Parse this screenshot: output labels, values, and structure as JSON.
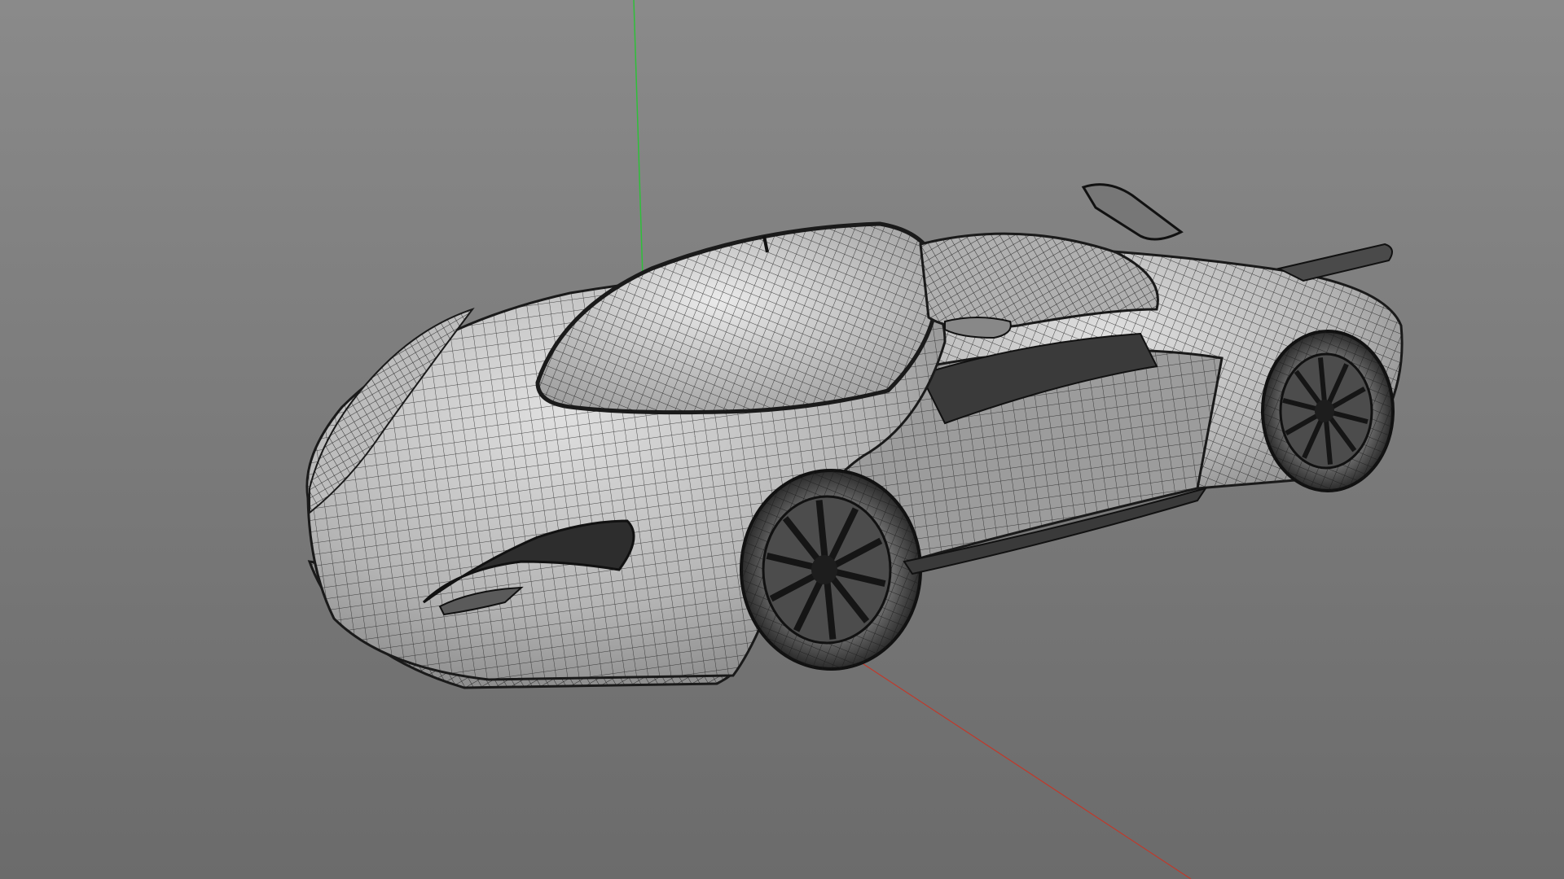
{
  "viewport": {
    "background_top": "#8a8a8a",
    "background_bottom": "#6b6b6b"
  },
  "axes": {
    "y_axis_color": "#2fbf3a",
    "x_axis_color": "#c0392b"
  },
  "model": {
    "kind": "car-wireframe",
    "wire_color": "#1a1a1a",
    "surface_light": "#d2d2d2",
    "surface_mid": "#a6a6a6",
    "surface_dark": "#5f5f5f"
  }
}
